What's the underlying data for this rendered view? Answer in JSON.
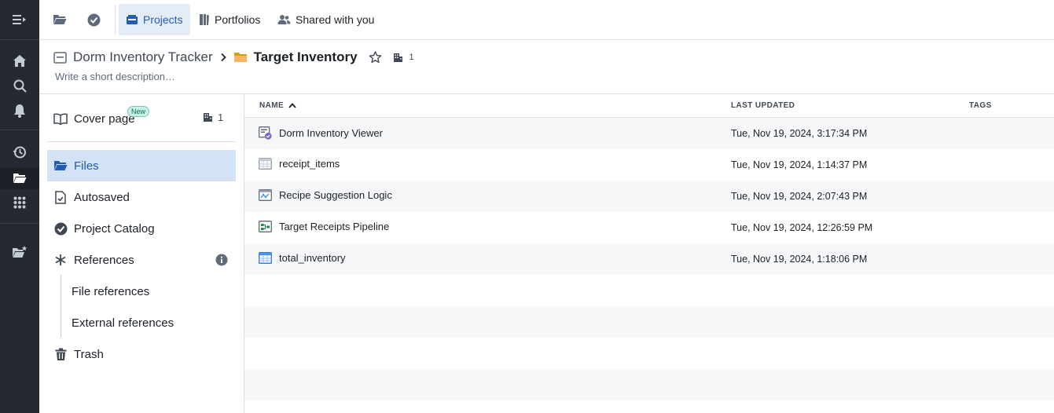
{
  "topbar": {
    "tabs": [
      {
        "label": "Projects",
        "active": true
      },
      {
        "label": "Portfolios",
        "active": false
      },
      {
        "label": "Shared with you",
        "active": false
      }
    ]
  },
  "header": {
    "parent": "Dorm Inventory Tracker",
    "current": "Target Inventory",
    "count": "1",
    "description_placeholder": "Write a short description…"
  },
  "sidebar": {
    "cover": {
      "label": "Cover page",
      "badge": "New",
      "count": "1"
    },
    "items": [
      {
        "label": "Files"
      },
      {
        "label": "Autosaved"
      },
      {
        "label": "Project Catalog"
      },
      {
        "label": "References"
      },
      {
        "label": "File references"
      },
      {
        "label": "External references"
      },
      {
        "label": "Trash"
      }
    ]
  },
  "table": {
    "columns": {
      "name": "NAME",
      "updated": "LAST UPDATED",
      "tags": "TAGS"
    },
    "rows": [
      {
        "name": "Dorm Inventory Viewer",
        "updated": "Tue, Nov 19, 2024, 3:17:34 PM",
        "icon": "workshop-app-icon"
      },
      {
        "name": "receipt_items",
        "updated": "Tue, Nov 19, 2024, 1:14:37 PM",
        "icon": "dataset-icon"
      },
      {
        "name": "Recipe Suggestion Logic",
        "updated": "Tue, Nov 19, 2024, 2:07:43 PM",
        "icon": "logic-icon"
      },
      {
        "name": "Target Receipts Pipeline",
        "updated": "Tue, Nov 19, 2024, 12:26:59 PM",
        "icon": "pipeline-icon"
      },
      {
        "name": "total_inventory",
        "updated": "Tue, Nov 19, 2024, 1:18:06 PM",
        "icon": "dataset-icon"
      }
    ]
  },
  "colors": {
    "accent": "#215db0",
    "rail": "#252a31",
    "active_bg": "#d3e2f5"
  }
}
